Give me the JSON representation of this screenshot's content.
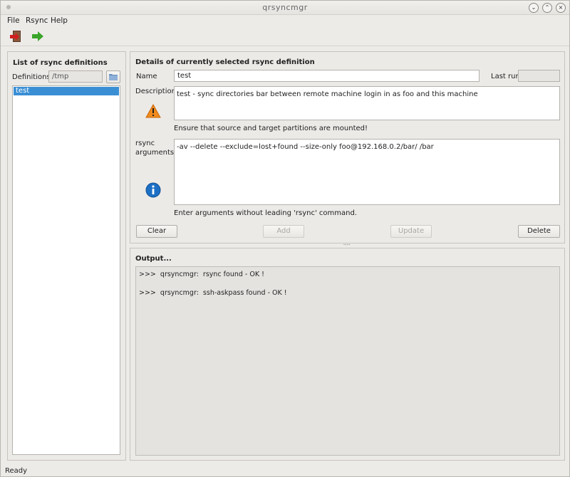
{
  "window": {
    "title": "qrsyncmgr"
  },
  "menu": [
    {
      "label": "File"
    },
    {
      "label": "Rsync"
    },
    {
      "label": "Help"
    }
  ],
  "toolbar": {
    "items": [
      {
        "icon": "exit-door-icon"
      },
      {
        "icon": "run-arrow-icon"
      }
    ]
  },
  "left_panel": {
    "title": "List of rsync definitions",
    "definitions_label": "Definitions",
    "definitions_path": "/tmp",
    "items": [
      "test"
    ]
  },
  "details": {
    "title": "Details of currently selected rsync definition",
    "name_label": "Name",
    "name_value": "test",
    "last_run_label": "Last run",
    "last_run_value": "",
    "description_label": "Description",
    "description_value": "test - sync directories bar between remote machine login in as foo and this machine",
    "warning_text": "Ensure that source and target partitions are mounted!",
    "args_label_1": "rsync",
    "args_label_2": "arguments",
    "args_value": "-av --delete --exclude=lost+found --size-only foo@192.168.0.2/bar/ /bar",
    "info_text": "Enter arguments without leading 'rsync' command.",
    "buttons": {
      "clear": "Clear",
      "add": "Add",
      "update": "Update",
      "delete": "Delete"
    }
  },
  "output": {
    "title": "Output...",
    "lines": [
      ">>>  qrsyncmgr:  rsync found - OK !",
      ">>>  qrsyncmgr:  ssh-askpass found - OK !"
    ]
  },
  "status": {
    "text": "Ready"
  },
  "colors": {
    "selection": "#3a8fd4",
    "warning": "#f08a1c",
    "info": "#1c6fc4"
  }
}
